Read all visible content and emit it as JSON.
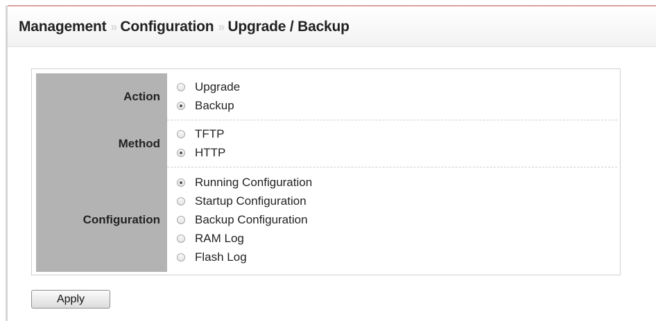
{
  "breadcrumb": {
    "items": [
      "Management",
      "Configuration",
      "Upgrade / Backup"
    ],
    "separator": "»"
  },
  "form": {
    "action": {
      "label": "Action",
      "options": [
        {
          "label": "Upgrade",
          "checked": false
        },
        {
          "label": "Backup",
          "checked": true
        }
      ]
    },
    "method": {
      "label": "Method",
      "options": [
        {
          "label": "TFTP",
          "checked": false
        },
        {
          "label": "HTTP",
          "checked": true
        }
      ]
    },
    "configuration": {
      "label": "Configuration",
      "options": [
        {
          "label": "Running Configuration",
          "checked": true
        },
        {
          "label": "Startup Configuration",
          "checked": false
        },
        {
          "label": "Backup Configuration",
          "checked": false
        },
        {
          "label": "RAM Log",
          "checked": false
        },
        {
          "label": "Flash Log",
          "checked": false
        }
      ]
    }
  },
  "buttons": {
    "apply_label": "Apply"
  },
  "colors": {
    "label_background": "#b3b3b3",
    "header_rule": "#c0504d"
  }
}
